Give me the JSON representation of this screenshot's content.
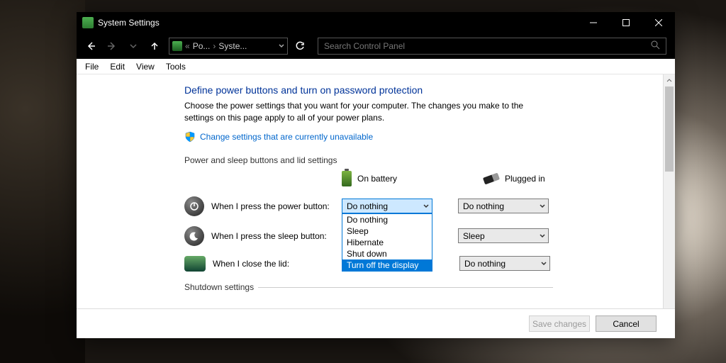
{
  "window": {
    "title": "System Settings"
  },
  "breadcrumb": {
    "crumb1": "Po...",
    "crumb2": "Syste..."
  },
  "search": {
    "placeholder": "Search Control Panel"
  },
  "menubar": [
    "File",
    "Edit",
    "View",
    "Tools"
  ],
  "page": {
    "title": "Define power buttons and turn on password protection",
    "desc": "Choose the power settings that you want for your computer. The changes you make to the settings on this page apply to all of your power plans.",
    "change_link": "Change settings that are currently unavailable",
    "section1": "Power and sleep buttons and lid settings",
    "col_battery": "On battery",
    "col_plugged": "Plugged in",
    "rows": [
      {
        "label": "When I press the power button:",
        "battery": "Do nothing",
        "plugged": "Do nothing"
      },
      {
        "label": "When I press the sleep button:",
        "battery": "",
        "plugged": "Sleep"
      },
      {
        "label": "When I close the lid:",
        "battery": "",
        "plugged": "Do nothing"
      }
    ],
    "dropdown_options": [
      "Do nothing",
      "Sleep",
      "Hibernate",
      "Shut down",
      "Turn off the display"
    ],
    "dropdown_highlight": "Turn off the display",
    "section2": "Shutdown settings"
  },
  "footer": {
    "save": "Save changes",
    "cancel": "Cancel"
  }
}
